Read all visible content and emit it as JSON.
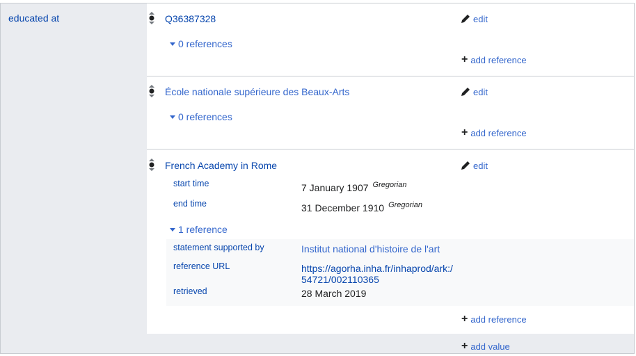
{
  "property": {
    "label": "educated at"
  },
  "statements": [
    {
      "value": "Q36387328",
      "edit_label": "edit",
      "references_toggle": "0 references",
      "add_reference_label": "add reference"
    },
    {
      "value": "École nationale supérieure des Beaux-Arts",
      "edit_label": "edit",
      "references_toggle": "0 references",
      "add_reference_label": "add reference"
    },
    {
      "value": "French Academy in Rome",
      "edit_label": "edit",
      "qualifiers": [
        {
          "label": "start time",
          "value": "7 January 1907",
          "calendar": "Gregorian"
        },
        {
          "label": "end time",
          "value": "31 December 1910",
          "calendar": "Gregorian"
        }
      ],
      "references_toggle": "1 reference",
      "reference": [
        {
          "label": "statement supported by",
          "value": "Institut national d'histoire de l'art"
        },
        {
          "label": "reference URL",
          "value": "https://agorha.inha.fr/inhaprod/ark:/",
          "value_line2": "54721/002110365"
        },
        {
          "label": "retrieved",
          "value": "28 March 2019"
        }
      ],
      "add_reference_label": "add reference"
    }
  ],
  "add_value_label": "add value",
  "icons": {
    "rank": "rank-normal-icon",
    "edit": "pencil-icon",
    "add": "plus-icon",
    "expand": "triangle-down-icon"
  },
  "colors": {
    "link": "#3366cc",
    "property_link": "#0645ad",
    "sidebar_bg": "#eaecf0",
    "border": "#c8ccd1"
  }
}
